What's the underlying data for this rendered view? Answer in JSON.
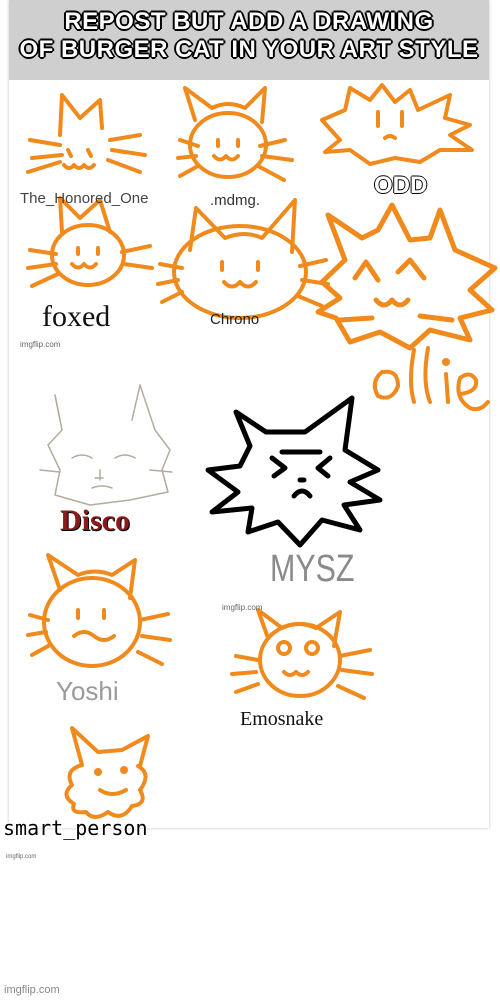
{
  "meme": {
    "title_line1": "REPOST BUT ADD A DRAWING",
    "title_line2": "OF BURGER CAT IN YOUR ART STYLE",
    "watermark": "imgflip.com"
  },
  "labels": {
    "the_honored_one": "The_Honored_One",
    "mdmg": ".mdmg.",
    "odd": "ODD",
    "foxed": "foxed",
    "chrono": "Chrono",
    "ollie": "ollie",
    "disco": "Disco",
    "mysz": "MYSZ",
    "yoshi": "Yoshi",
    "emosnake": "Emosnake",
    "smart_person": "smart_person"
  },
  "colors": {
    "orange": "#f08a1c",
    "black": "#000000",
    "disco_red": "#8b1a1a",
    "gray_text": "#8a8a8a"
  }
}
